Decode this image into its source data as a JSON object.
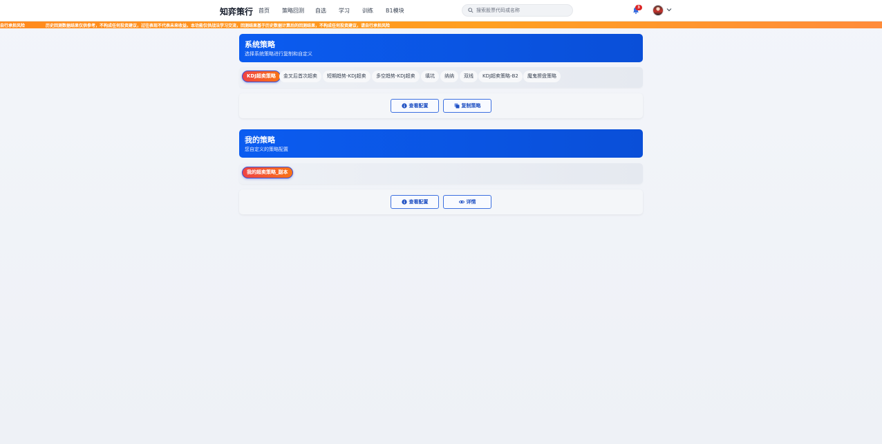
{
  "nav": {
    "brand": "知弈策行",
    "items": [
      "首页",
      "策略回测",
      "自选",
      "学习",
      "训练",
      "B1模块"
    ],
    "search_placeholder": "搜索股票代码或名称",
    "notification_count": "3"
  },
  "banner": {
    "text_left": "自行承担风险",
    "text_main": "历史回测数据结果仅供参考，不构成任何投资建议，过往表现不代表未来收益。本功能仅供战法学习交流，回测结果基于历史数据计算后的回测结果，不构成任何投资建议，请自行承担风险"
  },
  "system_section": {
    "title": "系统策略",
    "subtitle": "选择系统策略进行复制和自定义",
    "strategies": [
      "KDJ超卖策略",
      "金叉后首次超卖",
      "短期趋势-KDJ超卖",
      "多空趋势-KDJ超卖",
      "填坑",
      "纳纳",
      "双线",
      "KDJ超卖策略-B2",
      "魔鬼擦盘策略"
    ],
    "active_index": 0,
    "view_config_label": "查看配置",
    "copy_label": "复制策略"
  },
  "my_section": {
    "title": "我的策略",
    "subtitle": "您自定义的策略配置",
    "strategies": [
      "我的超卖策略_副本"
    ],
    "view_config_label": "查看配置",
    "details_label": "详情"
  },
  "colors": {
    "accent_blue": "#0b5cf0",
    "banner_orange": "#ff8a1c",
    "active_pill_start": "#ef4444",
    "active_pill_end": "#f97316"
  }
}
